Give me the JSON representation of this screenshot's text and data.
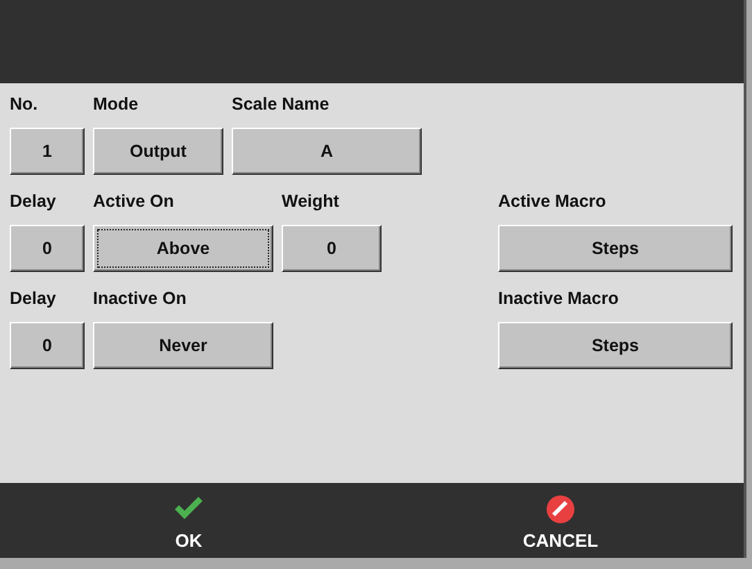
{
  "rows": [
    {
      "fields": [
        {
          "kind": "number",
          "label": "No.",
          "value": "1",
          "focused": false
        },
        {
          "kind": "select",
          "label": "Mode",
          "value": "Output",
          "focused": false
        },
        {
          "kind": "name",
          "label": "Scale Name",
          "value": "A",
          "focused": false
        }
      ]
    },
    {
      "fields": [
        {
          "kind": "number",
          "label": "Delay",
          "value": "0",
          "focused": false
        },
        {
          "kind": "mode",
          "label": "Active On",
          "value": "Above",
          "focused": true
        },
        {
          "kind": "weight",
          "label": "Weight",
          "value": "0",
          "focused": false
        },
        {
          "kind": "macro",
          "label": "Active Macro",
          "value": "Steps",
          "focused": false
        }
      ]
    },
    {
      "fields": [
        {
          "kind": "number",
          "label": "Delay",
          "value": "0",
          "focused": false
        },
        {
          "kind": "mode",
          "label": "Inactive On",
          "value": "Never",
          "focused": false
        },
        {
          "kind": "macro",
          "label": "Inactive Macro",
          "value": "Steps",
          "focused": false
        }
      ]
    }
  ],
  "actions": [
    {
      "kind": "ok",
      "label": "OK"
    },
    {
      "kind": "cancel",
      "label": "CANCEL"
    }
  ]
}
